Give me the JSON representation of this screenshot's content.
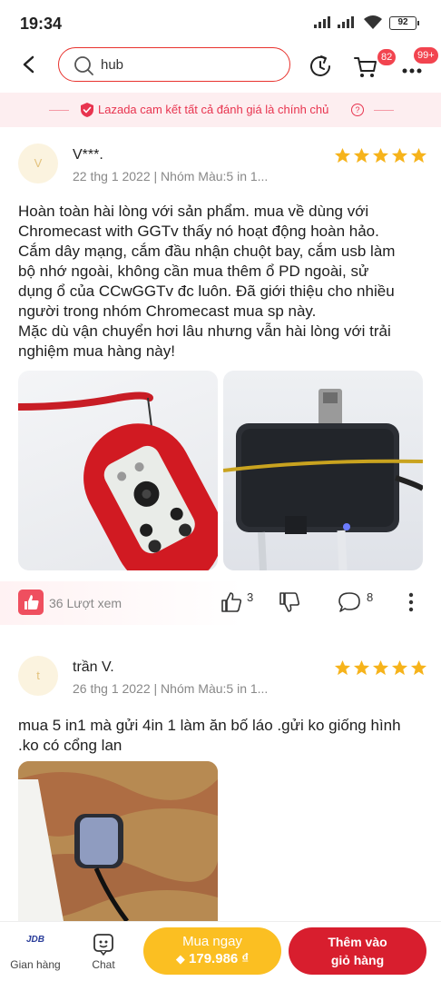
{
  "status_bar": {
    "time": "19:34",
    "battery": "92"
  },
  "header": {
    "search_text": "hub",
    "cart_badge": "82",
    "more_badge": "99+"
  },
  "trust_banner": {
    "text": "Lazada cam kết tất cả đánh giá là chính chủ",
    "help": "?"
  },
  "reviews": [
    {
      "avatar_letter": "V",
      "name": "V***.",
      "meta": "22 thg 1 2022 | Nhóm Màu:5 in 1...",
      "rating": 5,
      "text_lines": [
        "Hoàn toàn hài lòng với sản phẩm. mua về dùng với",
        "Chromecast with GGTv thấy nó hoạt động hoàn hảo.",
        "Cắm dây mạng, cắm đầu nhận chuột bay, cắm usb làm",
        "bộ nhớ ngoài, không cần mua thêm ổ PD ngoài, sử",
        "dụng ổ của CCwGGTv đc luôn. Đã giới thiệu cho nhiều",
        "người trong nhóm Chromecast mua sp này.",
        "Mặc dù vận chuyển hơi lâu nhưng vẫn hài lòng với trải",
        "nghiệm mua hàng này!"
      ],
      "views": "36 Lượt xem",
      "likes": "3",
      "comments": "8"
    },
    {
      "avatar_letter": "t",
      "name": "trần V.",
      "meta": "26 thg 1 2022 | Nhóm Màu:5 in 1...",
      "rating": 5,
      "text_lines": [
        "mua 5 in1 mà gửi 4in 1 làm ăn bố láo .gửi ko giống hình",
        ".ko có cổng lan"
      ]
    }
  ],
  "bottom_bar": {
    "shop_logo": "JDB",
    "shop_label": "Gian hàng",
    "chat_label": "Chat",
    "buy_now_label": "Mua ngay",
    "buy_now_price": "179.986 ₫",
    "add_to_cart_line1": "Thêm vào",
    "add_to_cart_line2": "giỏ hàng"
  },
  "colors": {
    "accent": "#e8332e",
    "star": "#f6b31b",
    "buy": "#fbbf22",
    "cart": "#d81e2e"
  }
}
